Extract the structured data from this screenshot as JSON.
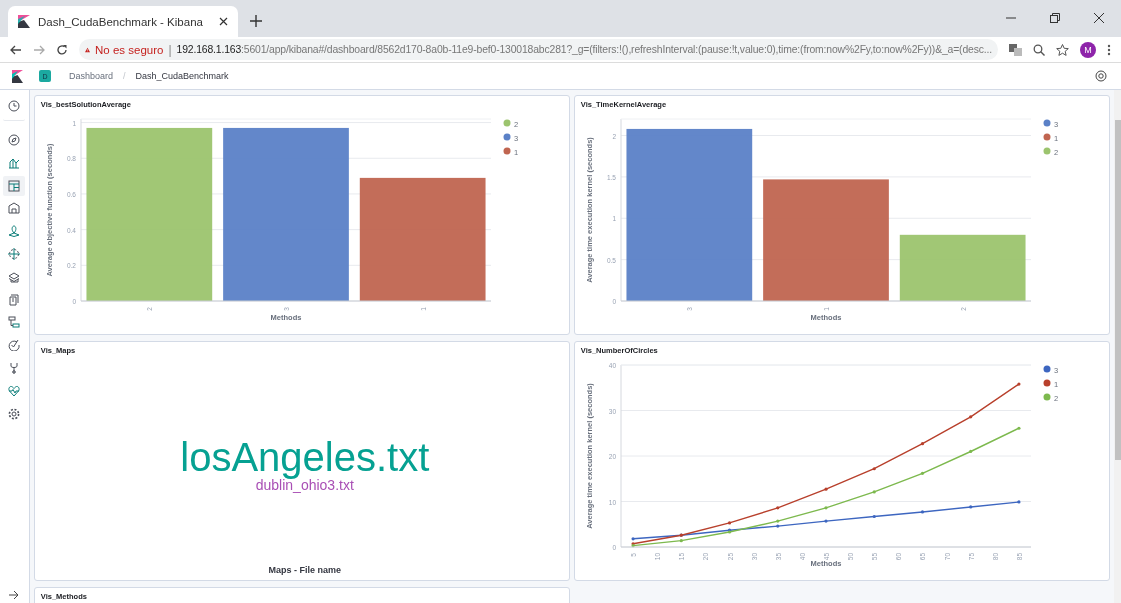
{
  "browser": {
    "tab": {
      "title": "Dash_CudaBenchmark - Kibana",
      "selected": true
    },
    "address": {
      "security": "No es seguro",
      "separator": "|",
      "host": "192.168.1.163",
      "path": ":5601/app/kibana#/dashboard/8562d170-8a0b-11e9-bef0-130018abc281?_g=(filters:!(),refreshInterval:(pause:!t,value:0),time:(from:now%2Fy,to:now%2Fy))&_a=(desc..."
    },
    "profile": "M"
  },
  "header": {
    "space": "D",
    "breadcrumbs": [
      {
        "label": "Dashboard"
      },
      {
        "label": "Dash_CudaBenchmark"
      }
    ],
    "separator": "/"
  },
  "sidebar": {
    "items": [
      {
        "selected": false
      },
      {
        "selected": false
      },
      {
        "selected": false
      },
      {
        "selected": true
      },
      {
        "selected": false
      },
      {
        "selected": false
      },
      {
        "selected": false
      },
      {
        "selected": false
      },
      {
        "selected": false
      },
      {
        "selected": false
      },
      {
        "selected": false
      },
      {
        "selected": false
      },
      {
        "selected": false
      },
      {
        "selected": false
      }
    ]
  },
  "panels": [
    {
      "title": "Vis_bestSolutionAverage",
      "kind": "bar",
      "chart_data": {
        "type": "bar",
        "xlabel": "Methods",
        "ylabel": "Average objective function (seconds)",
        "categories": [
          "2",
          "3",
          "1"
        ],
        "grid": true,
        "legend": "right",
        "ylim": [
          0,
          1.02
        ],
        "yticks": [
          0,
          0.2,
          0.4,
          0.6,
          0.8,
          1
        ],
        "series": [
          {
            "name": "2",
            "color": "#9cc46e",
            "values": [
              0.97,
              null,
              null
            ]
          },
          {
            "name": "3",
            "color": "#5b81c7",
            "values": [
              null,
              0.97,
              null
            ]
          },
          {
            "name": "1",
            "color": "#c06550",
            "values": [
              null,
              null,
              0.69
            ]
          }
        ]
      }
    },
    {
      "title": "Vis_TimeKernelAverage",
      "kind": "bar",
      "chart_data": {
        "type": "bar",
        "xlabel": "Methods",
        "ylabel": "Average time execution kernel (seconds)",
        "categories": [
          "3",
          "1",
          "2"
        ],
        "grid": true,
        "legend": "right",
        "ylim": [
          0,
          2.2
        ],
        "yticks": [
          0,
          0.5,
          1,
          1.5,
          2
        ],
        "series": [
          {
            "name": "3",
            "color": "#5b81c7",
            "values": [
              2.08,
              null,
              null
            ]
          },
          {
            "name": "1",
            "color": "#c06550",
            "values": [
              null,
              1.47,
              null
            ]
          },
          {
            "name": "2",
            "color": "#9cc46e",
            "values": [
              null,
              null,
              0.8
            ]
          }
        ]
      }
    },
    {
      "title": "Vis_Maps",
      "kind": "tagcloud",
      "words": [
        {
          "text": "losAngeles.txt",
          "color": "#06a192"
        },
        {
          "text": "dublin_ohio3.txt",
          "color": "#a94fb5"
        }
      ],
      "caption": "Maps - File name"
    },
    {
      "title": "Vis_NumberOfCircles",
      "kind": "line",
      "chart_data": {
        "type": "line",
        "xlabel": "Methods",
        "ylabel": "Average time execution kernel (seconds)",
        "x": [
          5,
          15,
          25,
          35,
          45,
          55,
          65,
          75,
          85
        ],
        "xlim": [
          2.5,
          87.5
        ],
        "grid": true,
        "legend": "right",
        "xticks": [
          5,
          10,
          15,
          20,
          25,
          30,
          35,
          40,
          45,
          50,
          55,
          60,
          65,
          70,
          75,
          80,
          85
        ],
        "ylim": [
          0,
          40
        ],
        "yticks": [
          0,
          10,
          20,
          30,
          40
        ],
        "series": [
          {
            "name": "3",
            "color": "#3d66c0",
            "values": [
              1.8,
              2.6,
              3.7,
              4.6,
              5.7,
              6.7,
              7.7,
              8.8,
              9.9
            ]
          },
          {
            "name": "1",
            "color": "#b8402c",
            "values": [
              0.7,
              2.6,
              5.3,
              8.6,
              12.7,
              17.2,
              22.7,
              28.6,
              35.8
            ]
          },
          {
            "name": "2",
            "color": "#7db94e",
            "values": [
              0.3,
              1.4,
              3.3,
              5.7,
              8.6,
              12.1,
              16.2,
              21.0,
              26.1
            ]
          }
        ]
      }
    },
    {
      "title": "Vis_Methods",
      "kind": "empty"
    }
  ]
}
